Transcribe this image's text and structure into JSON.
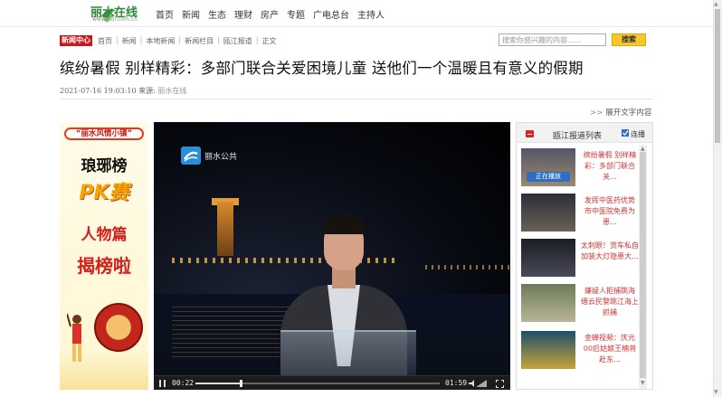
{
  "header": {
    "logo_text": "丽水在线",
    "logo_sub": "www.lsol.com.cn",
    "nav": [
      "首页",
      "新闻",
      "生态",
      "理财",
      "房产",
      "专题",
      "广电总台",
      "主持人"
    ]
  },
  "breadcrumb": {
    "tag": "新闻中心",
    "items": [
      "首页",
      "新闻",
      "本地新闻",
      "新闻栏目",
      "瓯江报道",
      "正文"
    ],
    "separator": "|"
  },
  "search": {
    "placeholder": "搜索你感兴趣的内容......",
    "button": "搜索"
  },
  "article": {
    "title": "缤纷暑假  别样精彩：多部门联合关爱困境儿童  送他们一个温暖且有意义的假期",
    "datetime": "2021-07-16 19:03:10",
    "source_label": "来源:",
    "source": "丽水在线"
  },
  "expand_text": "展开文字内容",
  "ad": {
    "top": "“丽水风情小镇”",
    "line1": "琅琊榜",
    "line2": "PK赛",
    "line3": "人物篇",
    "line4": "揭榜啦"
  },
  "video": {
    "station": "丽水公共",
    "current_time": "00:22",
    "duration": "01:59",
    "progress": 0.185
  },
  "sidebar": {
    "title": "瓯江报道列表",
    "autoplay_label": "连播",
    "autoplay_checked": true,
    "playing_label": "正在播放",
    "items": [
      {
        "text": "缤纷暑假 别样精彩：多部门联合关..."
      },
      {
        "text": "发挥中医药优势 市中医院免费为患..."
      },
      {
        "text": "太刺眼！货车私自加装大灯隐患大..."
      },
      {
        "text": "嫌疑人拒捕跳海 缙云民警跳江海上抓捕"
      },
      {
        "text": "金蝉视频：庆元00后姑娘王楠将赴东..."
      }
    ]
  },
  "colors": {
    "news_tag": "#c9171e",
    "search_button": "#f7c72b",
    "sidebar_link": "#c33"
  }
}
